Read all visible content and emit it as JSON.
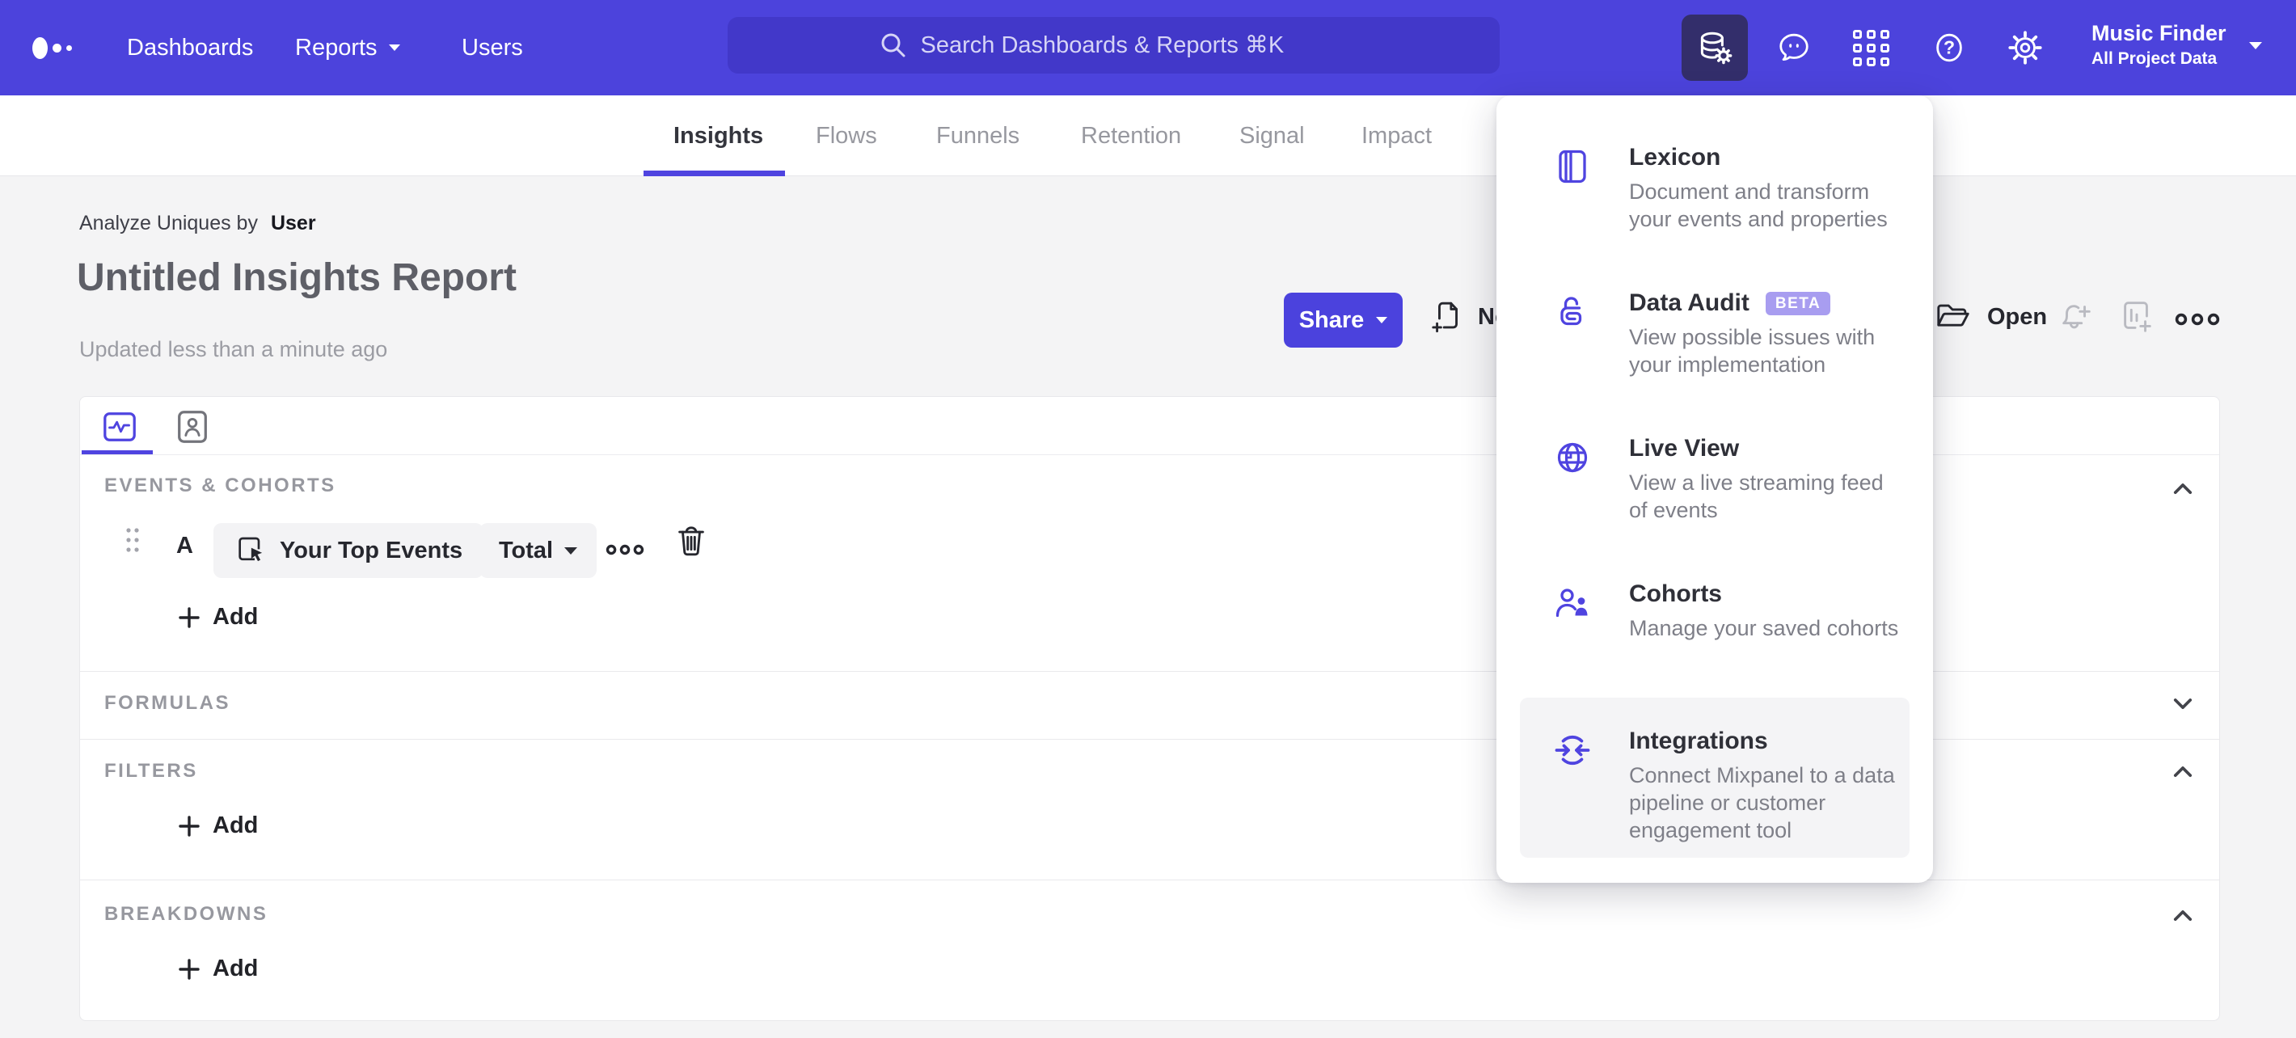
{
  "topbar": {
    "nav": [
      {
        "label": "Dashboards"
      },
      {
        "label": "Reports"
      },
      {
        "label": "Users"
      }
    ],
    "search": {
      "placeholder": "Search Dashboards & Reports ⌘K"
    },
    "project": {
      "name": "Music Finder",
      "scope": "All Project Data"
    }
  },
  "report_tabs": [
    "Insights",
    "Flows",
    "Funnels",
    "Retention",
    "Signal",
    "Impact"
  ],
  "active_tab": "Insights",
  "header": {
    "analyze_label": "Analyze Uniques by",
    "analyze_value": "User",
    "title": "Untitled Insights Report",
    "updated": "Updated less than a minute ago"
  },
  "actions": {
    "share": "Share",
    "new": "New",
    "open": "Open"
  },
  "builder": {
    "row": {
      "letter": "A",
      "event": "Your Top Events",
      "metric": "Total"
    },
    "add_label": "Add",
    "sections": [
      {
        "label": "EVENTS & COHORTS",
        "state": "expanded"
      },
      {
        "label": "FORMULAS",
        "state": "collapsed"
      },
      {
        "label": "FILTERS",
        "state": "expanded"
      },
      {
        "label": "BREAKDOWNS",
        "state": "expanded"
      }
    ]
  },
  "menu": {
    "items": [
      {
        "title": "Lexicon",
        "desc": "Document and transform your events and properties"
      },
      {
        "title": "Data Audit",
        "badge": "BETA",
        "desc": "View possible issues with your implementation"
      },
      {
        "title": "Live View",
        "desc": "View a live streaming feed of events"
      },
      {
        "title": "Cohorts",
        "desc": "Manage your saved cohorts"
      },
      {
        "title": "Integrations",
        "desc": "Connect Mixpanel to a data pipeline or customer engagement tool"
      }
    ]
  },
  "colors": {
    "accent": "#4f44e0",
    "topbar": "#4c43dc",
    "search_bg": "#4238c9",
    "active_icon_bg": "#332e6b",
    "page_bg": "#f4f4f5",
    "beta_badge": "#a89df0"
  }
}
